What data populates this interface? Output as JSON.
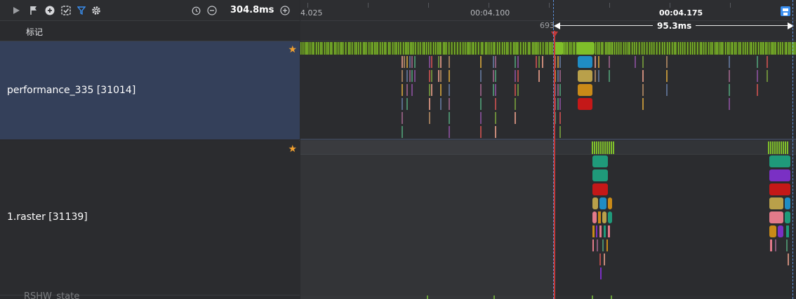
{
  "toolbar": {
    "icons": [
      "play-icon",
      "flag-icon",
      "plus-circle-icon",
      "checkbox-icon",
      "filter-icon",
      "gear-icon",
      "timer-icon",
      "zoom-out-icon",
      "zoom-in-icon"
    ],
    "duration": "304.8ms"
  },
  "marks": {
    "label": "标记"
  },
  "rows": [
    {
      "label": "performance_335 [31014]",
      "starred": true
    },
    {
      "label": "1.raster [31139]",
      "starred": true
    },
    {
      "label": "RSHW_state"
    }
  ],
  "ruler": {
    "ticks": [
      "4.025",
      "00:04.100",
      "00:04.175"
    ],
    "marker_value": "693",
    "selection": "95.3ms"
  },
  "colors": {
    "selected_row": "#34405a",
    "cursor": "#c43a3a",
    "selection_edge": "#5b8fd6",
    "thread_green": "#7fbf2a",
    "star": "#f0a030"
  }
}
